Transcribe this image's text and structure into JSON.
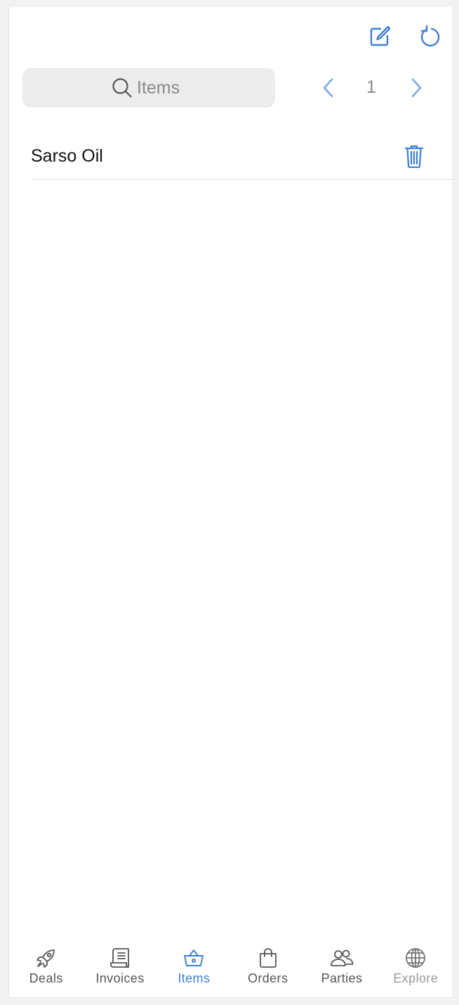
{
  "colors": {
    "accent": "#3d7fd6",
    "accent_light": "#7ea7e6",
    "tab_inactive": "#555555",
    "tab_muted": "#999999",
    "search_bg": "#ececec"
  },
  "toolbar": {
    "compose_icon": "compose-icon",
    "refresh_icon": "refresh-icon"
  },
  "search": {
    "placeholder": "Items",
    "value": ""
  },
  "pager": {
    "page": "1"
  },
  "items": [
    {
      "name": "Sarso Oil",
      "delete_icon": "trash-icon"
    }
  ],
  "tabbar": {
    "active": "Items",
    "tabs": [
      {
        "label": "Deals",
        "icon": "rocket-icon"
      },
      {
        "label": "Invoices",
        "icon": "receipt-icon"
      },
      {
        "label": "Items",
        "icon": "basket-icon"
      },
      {
        "label": "Orders",
        "icon": "bag-icon"
      },
      {
        "label": "Parties",
        "icon": "people-icon"
      },
      {
        "label": "Explore",
        "icon": "globe-icon"
      }
    ]
  }
}
